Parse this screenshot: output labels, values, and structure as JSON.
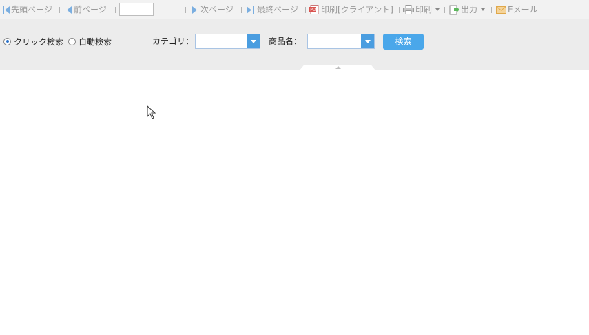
{
  "toolbar": {
    "first_page": "先頭ページ",
    "prev_page": "前ページ",
    "page_value": "",
    "next_page": "次ページ",
    "last_page": "最終ページ",
    "print_client": "印刷[クライアント]",
    "print": "印刷",
    "output": "出力",
    "email": "Eメール"
  },
  "search": {
    "mode_click": "クリック検索",
    "mode_auto": "自動検索",
    "selected_mode": "click",
    "category_label": "カテゴリ：",
    "category_value": "",
    "product_label": "商品名：",
    "product_value": "",
    "search_button": "検索"
  },
  "colors": {
    "accent": "#4aa7ea",
    "combo_button": "#4a9de0",
    "toolbar_text": "#9a9a9a"
  }
}
